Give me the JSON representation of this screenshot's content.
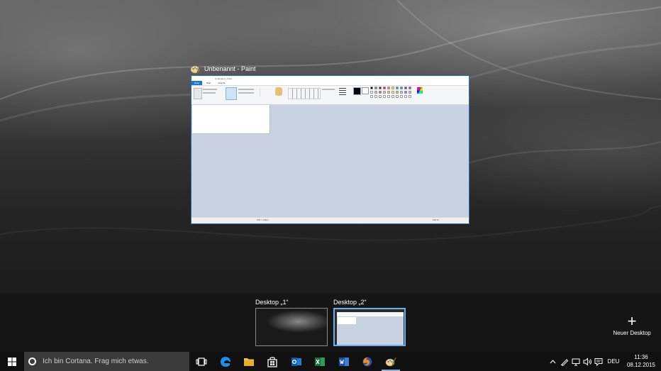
{
  "window": {
    "title": "Unbenannt - Paint"
  },
  "paint": {
    "titlebar_text": "Unbenannt - Paint",
    "tabs": [
      "Datei",
      "Start",
      "Ansicht"
    ],
    "status_size": "378 × 141px",
    "zoom": "100 %"
  },
  "desktops": [
    {
      "label": "Desktop „1“",
      "selected": false
    },
    {
      "label": "Desktop „2“",
      "selected": true
    }
  ],
  "new_desktop": {
    "icon": "plus-icon",
    "label": "Neuer Desktop"
  },
  "taskbar": {
    "search_placeholder": "Ich bin Cortana. Frag mich etwas.",
    "apps": [
      "task-view",
      "edge",
      "file-explorer",
      "store",
      "outlook",
      "excel",
      "word",
      "firefox",
      "paint"
    ],
    "language": "DEU",
    "time": "11:36",
    "date": "08.12.2015"
  },
  "colors": {
    "accent": "#1979ca",
    "selection": "#6ab0f0",
    "taskbar": "#101010",
    "search_box": "#3a3a3a"
  }
}
